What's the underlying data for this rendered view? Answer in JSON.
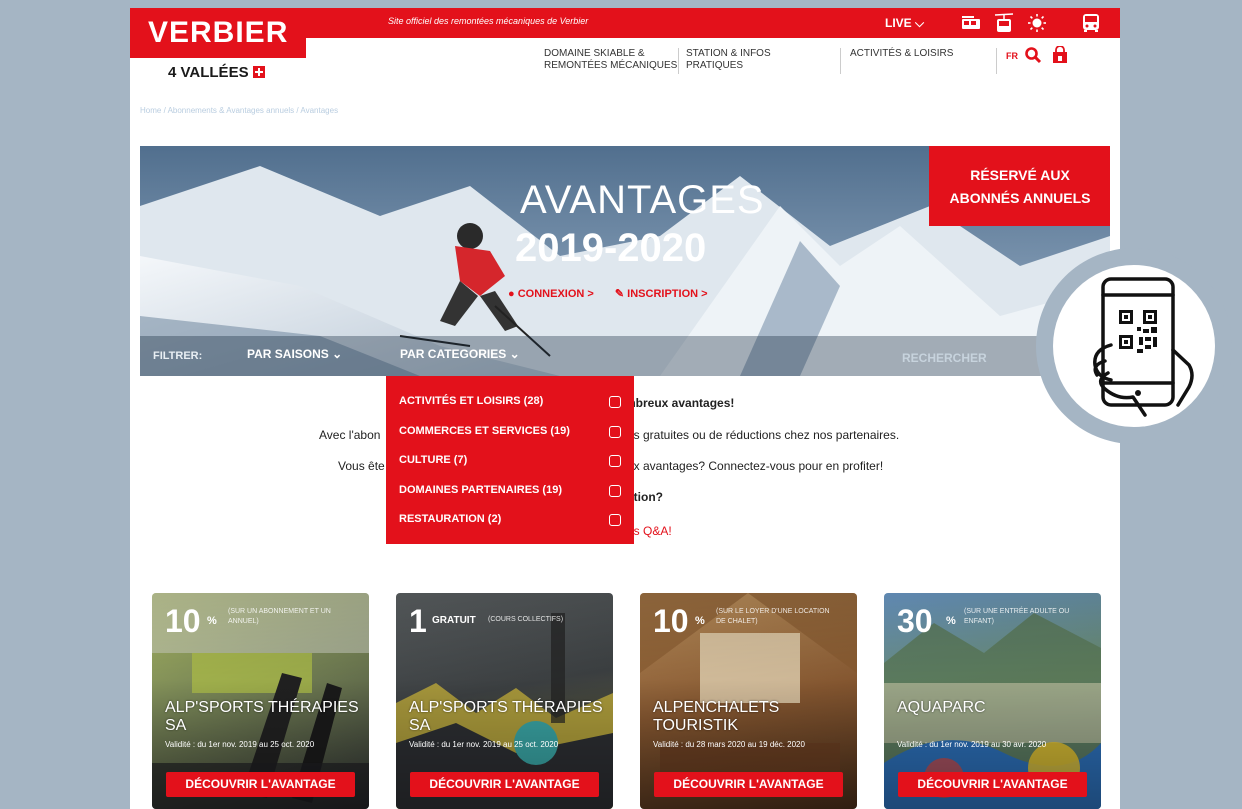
{
  "topbar": {
    "tagline": "Site officiel des remontées mécaniques de Verbier",
    "live_label": "LIVE ⌵",
    "icons": [
      "cable-car-icon",
      "gondola-icon",
      "sun-icon",
      "bus-icon"
    ]
  },
  "logo": {
    "name": "VERBIER",
    "sub": "4 VALLÉES"
  },
  "nav": {
    "items": [
      {
        "line1": "DOMAINE SKIABLE &",
        "line2": "REMONTÉES MÉCANIQUES"
      },
      {
        "line1": "STATION & INFOS",
        "line2": "PRATIQUES"
      },
      {
        "line1": "ACTIVITÉS & LOISIRS",
        "line2": ""
      }
    ],
    "lang": "FR"
  },
  "breadcrumb": "Home / Abonnements & Avantages annuels / Avantages",
  "hero": {
    "title": "AVANTAGES",
    "year": "2019-2020",
    "login_label": "CONNEXION >",
    "signup_label": "INSCRIPTION >",
    "reserve_line1": "RÉSERVÉ AUX",
    "reserve_line2": "ABONNÉS ANNUELS"
  },
  "filter": {
    "label": "FILTRER:",
    "seasons": "PAR SAISONS",
    "categories": "PAR CATEGORIES",
    "search": "RECHERCHER"
  },
  "dropdown": {
    "items": [
      {
        "label": "ACTIVITÉS ET LOISIRS (28)"
      },
      {
        "label": "COMMERCES ET SERVICES (19)"
      },
      {
        "label": "CULTURE (7)"
      },
      {
        "label": "DOMAINES PARTENAIRES (19)"
      },
      {
        "label": "RESTAURATION (2)"
      }
    ]
  },
  "content": {
    "headline_tail": "mbreux avantages!",
    "line1_start": "Avec l'abon",
    "line1_end": "es gratuites ou de réductions chez nos partenaires.",
    "line2_start": "Vous ête",
    "line2_end": "ux avantages? Connectez-vous pour en profiter!",
    "question_tail": "stion?",
    "faq_tail": "os Q&A!"
  },
  "cards": [
    {
      "num": "10",
      "unit": "%",
      "note": "(sur un abonnement et un annuel)",
      "name": "ALP'SPORTS THÉRAPIES SA",
      "validity": "Validité : du 1er nov. 2019 au 25 oct. 2020",
      "cta": "DÉCOUVRIR L'AVANTAGE"
    },
    {
      "num": "1",
      "unit": "GRATUIT",
      "note": "(cours collectifs)",
      "name": "ALP'SPORTS THÉRAPIES SA",
      "validity": "Validité : du 1er nov. 2019 au 25 oct. 2020",
      "cta": "DÉCOUVRIR L'AVANTAGE"
    },
    {
      "num": "10",
      "unit": "%",
      "note": "(sur le loyer d'une location de chalet)",
      "name": "ALPENCHALETS TOURISTIK",
      "validity": "Validité : du 28 mars 2020 au 19 déc. 2020",
      "cta": "DÉCOUVRIR L'AVANTAGE"
    },
    {
      "num": "30",
      "unit": "%",
      "note": "(sur une entrée adulte ou enfant)",
      "name": "AQUAPARC",
      "validity": "Validité : du 1er nov. 2019 au 30 avr. 2020",
      "cta": "DÉCOUVRIR L'AVANTAGE"
    }
  ],
  "colors": {
    "brand_red": "#e3111b",
    "frame": "#a5b5c4"
  }
}
